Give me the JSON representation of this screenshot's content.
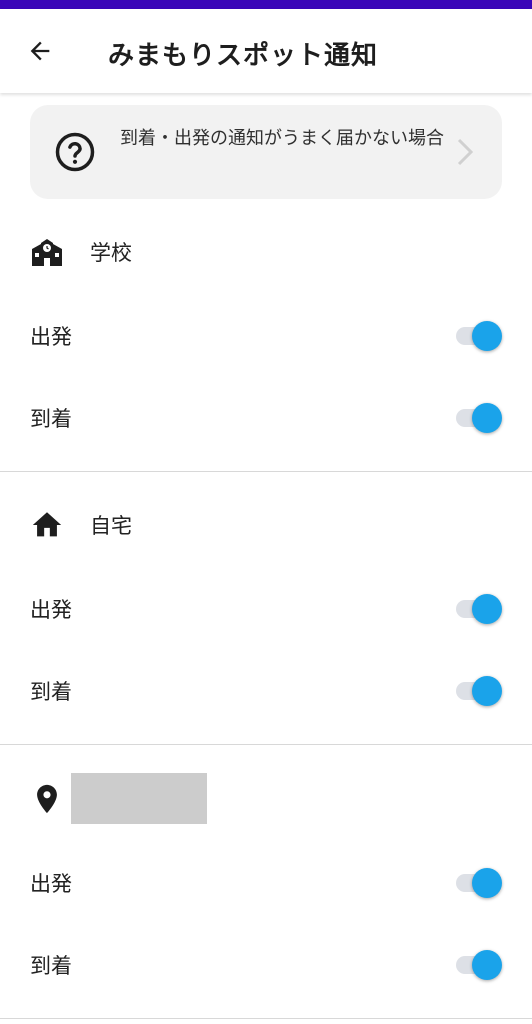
{
  "header": {
    "title": "みまもりスポット通知"
  },
  "help_card": {
    "text": "到着・出発の通知がうまく届かない場合"
  },
  "sections": [
    {
      "name": "学校",
      "icon": "school-icon",
      "rows": [
        {
          "label": "出発",
          "enabled": true
        },
        {
          "label": "到着",
          "enabled": true
        }
      ]
    },
    {
      "name": "自宅",
      "icon": "home-icon",
      "rows": [
        {
          "label": "出発",
          "enabled": true
        },
        {
          "label": "到着",
          "enabled": true
        }
      ]
    },
    {
      "name": "",
      "icon": "location-pin-icon",
      "rows": [
        {
          "label": "出発",
          "enabled": true
        },
        {
          "label": "到着",
          "enabled": true
        }
      ]
    }
  ],
  "colors": {
    "status_bar": "#3a06b8",
    "toggle_on": "#1aa3ea",
    "toggle_track": "#dde0e6",
    "card_bg": "#f2f2f2"
  }
}
